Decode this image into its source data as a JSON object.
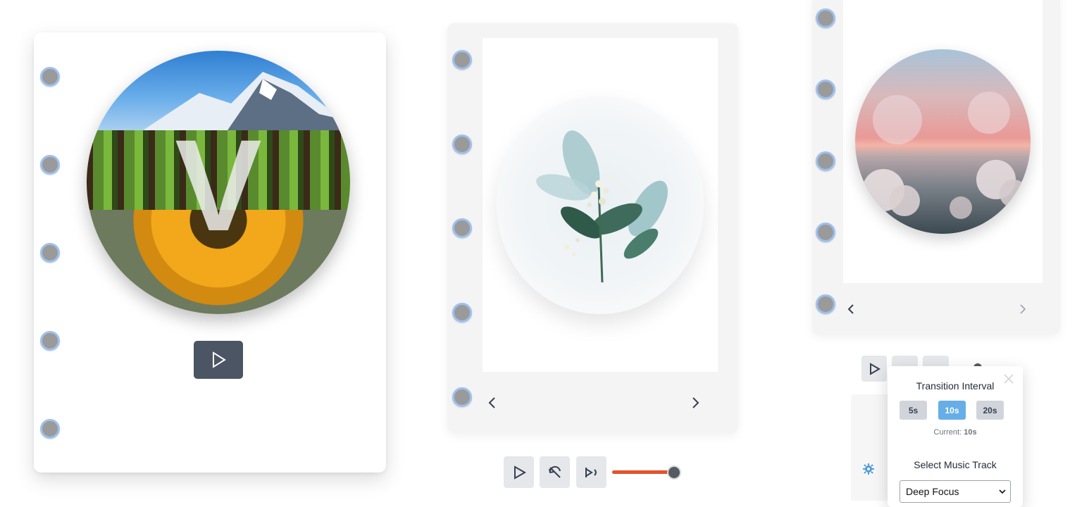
{
  "card1": {
    "monogram": "V"
  },
  "popover": {
    "interval_title": "Transition Interval",
    "interval_options": [
      "5s",
      "10s",
      "20s"
    ],
    "current_label": "Current:",
    "current_value": "10s",
    "music_title": "Select Music Track",
    "selected_track": "Deep Focus"
  },
  "controls": {
    "volume_level": 0.8
  },
  "colors": {
    "accent": "#e2532b",
    "active_pill": "#66aee7",
    "play_button_bg": "#4b5563",
    "ring_border": "#9ec0ee"
  },
  "icons": [
    "play-icon",
    "repeat-off-icon",
    "shuffle-icon",
    "chevron-left-icon",
    "chevron-right-icon",
    "close-icon",
    "gear-icon",
    "chevron-down-icon"
  ]
}
